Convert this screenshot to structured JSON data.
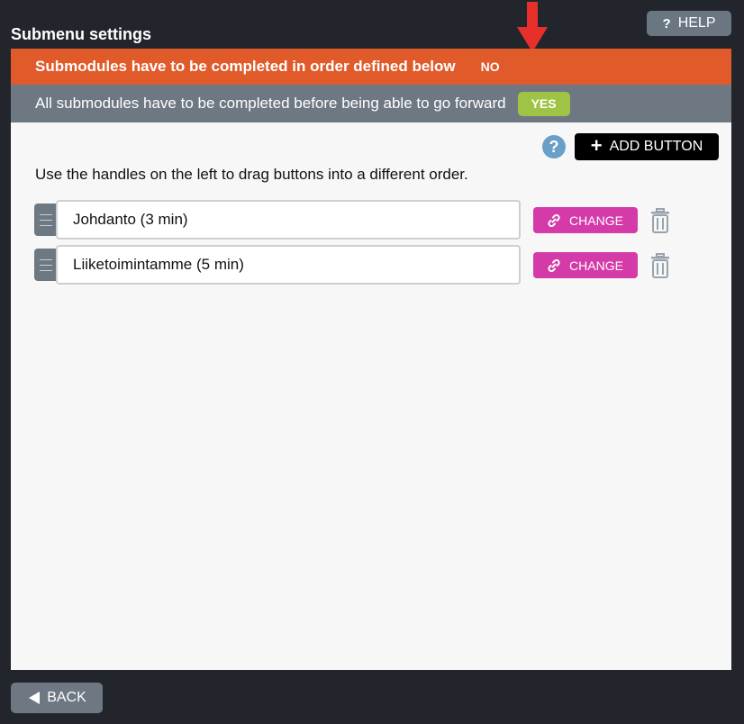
{
  "header": {
    "title": "Submenu settings",
    "help_label": "HELP",
    "help_icon": "?"
  },
  "settings": {
    "order_label": "Submodules have to be completed in order defined below",
    "order_value": "NO",
    "all_complete_label": "All submodules have to be completed before being able to go forward",
    "all_complete_value": "YES"
  },
  "toolbar": {
    "info_icon": "?",
    "add_button_label": "ADD BUTTON"
  },
  "instructions": "Use the handles on the left to drag buttons into a different order.",
  "items": [
    {
      "label": "Johdanto (3 min)",
      "change_label": "CHANGE"
    },
    {
      "label": "Liiketoimintamme (5 min)",
      "change_label": "CHANGE"
    }
  ],
  "footer": {
    "back_label": "BACK"
  },
  "colors": {
    "background": "#22252b",
    "orange_row": "#e05a2a",
    "grey_row": "#6e7883",
    "yes_badge": "#9ec345",
    "change_button": "#d43aa8",
    "add_button": "#000000",
    "arrow": "#e8302a"
  },
  "icons": [
    "help-icon",
    "red-arrow-icon",
    "info-icon",
    "plus-icon",
    "drag-handle-icon",
    "link-icon",
    "trash-icon",
    "back-arrow-icon"
  ]
}
